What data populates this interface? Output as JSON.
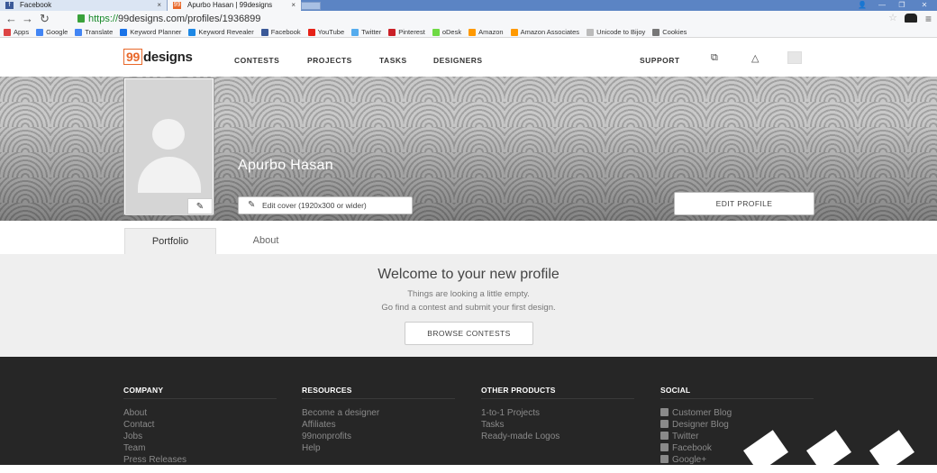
{
  "browser": {
    "tabs": [
      {
        "label": "Facebook",
        "favicon_color": "#3b5998"
      },
      {
        "label": "Apurbo Hasan | 99designs",
        "favicon_color": "#e8682a"
      }
    ],
    "tab_close": "×",
    "url_scheme": "https://",
    "url_rest": "99designs.com/profiles/1936899",
    "bookmarks": [
      {
        "label": "Apps",
        "color": "#d44"
      },
      {
        "label": "Google",
        "color": "#4285f4"
      },
      {
        "label": "Translate",
        "color": "#4285f4"
      },
      {
        "label": "Keyword Planner",
        "color": "#1a73e8"
      },
      {
        "label": "Keyword Revealer",
        "color": "#1e88e5"
      },
      {
        "label": "Facebook",
        "color": "#3b5998"
      },
      {
        "label": "YouTube",
        "color": "#e62117"
      },
      {
        "label": "Twitter",
        "color": "#55acee"
      },
      {
        "label": "Pinterest",
        "color": "#cb2027"
      },
      {
        "label": "oDesk",
        "color": "#6fda44"
      },
      {
        "label": "Amazon",
        "color": "#ff9900"
      },
      {
        "label": "Amazon Associates",
        "color": "#ff9900"
      },
      {
        "label": "Unicode to Bijoy",
        "color": "#bbbbbb"
      },
      {
        "label": "Cookies",
        "color": "#777777"
      }
    ]
  },
  "header": {
    "logo_num": "99",
    "logo_word": "designs",
    "nav": [
      "CONTESTS",
      "PROJECTS",
      "TASKS",
      "DESIGNERS"
    ],
    "support": "SUPPORT"
  },
  "profile": {
    "name": "Apurbo Hasan",
    "edit_cover": "Edit cover (1920x300 or wider)",
    "edit_profile": "EDIT PROFILE"
  },
  "tabs": [
    "Portfolio",
    "About"
  ],
  "welcome": {
    "title": "Welcome to your new profile",
    "line1": "Things are looking a little empty.",
    "line2": "Go find a contest and submit your first design.",
    "button": "BROWSE CONTESTS"
  },
  "footer": {
    "company": {
      "title": "COMPANY",
      "links": [
        "About",
        "Contact",
        "Jobs",
        "Team",
        "Press Releases"
      ]
    },
    "resources": {
      "title": "RESOURCES",
      "links": [
        "Become a designer",
        "Affiliates",
        "99nonprofits",
        "Help"
      ]
    },
    "other": {
      "title": "OTHER PRODUCTS",
      "links": [
        "1-to-1 Projects",
        "Tasks",
        "Ready-made Logos"
      ]
    },
    "social": {
      "title": "SOCIAL",
      "links": [
        "Customer Blog",
        "Designer Blog",
        "Twitter",
        "Facebook",
        "Google+"
      ]
    }
  }
}
